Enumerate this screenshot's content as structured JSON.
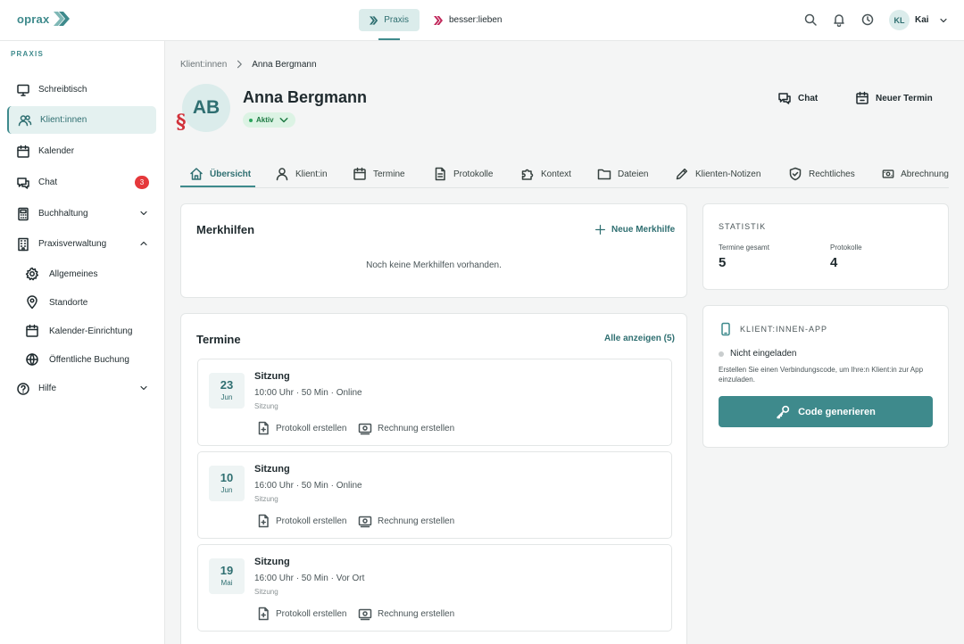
{
  "topbar": {
    "logo_text": "oprax",
    "workspaces": [
      {
        "label": "Praxis",
        "active": true
      },
      {
        "label": "besser:lieben",
        "active": false
      }
    ],
    "icons": [
      "search-icon",
      "bell-icon",
      "clock-icon"
    ],
    "user": {
      "initials": "KL",
      "name": "Kai"
    }
  },
  "sidebar": {
    "section": "PRAXIS",
    "items": [
      {
        "label": "Schreibtisch",
        "icon": "monitor-icon"
      },
      {
        "label": "Klient:innen",
        "icon": "users-icon",
        "active": true
      },
      {
        "label": "Kalender",
        "icon": "calendar-icon"
      },
      {
        "label": "Chat",
        "icon": "chat-icon",
        "badge": "3"
      },
      {
        "label": "Buchhaltung",
        "icon": "calculator-icon",
        "expandable": true
      },
      {
        "label": "Praxisverwaltung",
        "icon": "building-icon",
        "expanded": true
      },
      {
        "label": "Hilfe",
        "icon": "help-icon",
        "expandable": true
      }
    ],
    "subitems": [
      {
        "label": "Allgemeines",
        "icon": "gear-icon"
      },
      {
        "label": "Standorte",
        "icon": "map-pin-icon"
      },
      {
        "label": "Kalender-Einrichtung",
        "icon": "calendar-icon"
      },
      {
        "label": "Öffentliche Buchung",
        "icon": "globe-icon"
      }
    ]
  },
  "breadcrumb": {
    "parent": "Klient:innen",
    "current": "Anna Bergmann"
  },
  "client": {
    "initials": "AB",
    "name": "Anna Bergmann",
    "status": "Aktiv",
    "mark": "§"
  },
  "header_actions": {
    "chat": "Chat",
    "new_appointment": "Neuer Termin"
  },
  "tabs": [
    {
      "label": "Übersicht",
      "icon": "home-icon",
      "active": true
    },
    {
      "label": "Klient:in",
      "icon": "user-icon"
    },
    {
      "label": "Termine",
      "icon": "calendar-icon"
    },
    {
      "label": "Protokolle",
      "icon": "document-icon"
    },
    {
      "label": "Kontext",
      "icon": "puzzle-icon"
    },
    {
      "label": "Dateien",
      "icon": "folder-icon"
    },
    {
      "label": "Klienten-Notizen",
      "icon": "pen-icon"
    },
    {
      "label": "Rechtliches",
      "icon": "shield-icon"
    },
    {
      "label": "Abrechnung",
      "icon": "money-icon"
    }
  ],
  "merkhilfen": {
    "title": "Merkhilfen",
    "add_label": "Neue Merkhilfe",
    "empty": "Noch keine Merkhilfen vorhanden."
  },
  "termine": {
    "title": "Termine",
    "show_all": "Alle anzeigen (5)",
    "items": [
      {
        "day": "23",
        "month": "Jun",
        "title": "Sitzung",
        "meta": "10:00 Uhr · 50 Min · Online",
        "type": "Sitzung"
      },
      {
        "day": "10",
        "month": "Jun",
        "title": "Sitzung",
        "meta": "16:00 Uhr · 50 Min · Online",
        "type": "Sitzung"
      },
      {
        "day": "19",
        "month": "Mai",
        "title": "Sitzung",
        "meta": "16:00 Uhr · 50 Min · Vor Ort",
        "type": "Sitzung"
      }
    ],
    "action_protocol": "Protokoll erstellen",
    "action_invoice": "Rechnung erstellen"
  },
  "statistik": {
    "title": "STATISTIK",
    "appointments_label": "Termine gesamt",
    "appointments_value": "5",
    "protocols_label": "Protokolle",
    "protocols_value": "4"
  },
  "client_app": {
    "title": "KLIENT:INNEN-APP",
    "status": "Nicht eingeladen",
    "description": "Erstellen Sie einen Verbindungscode, um Ihre:n Klient:in zur App einzuladen.",
    "button": "Code generieren"
  },
  "colors": {
    "accent": "#3e8a8c",
    "accent_light": "#dbeceb",
    "badge": "#e5383b",
    "status": "#2aa55c"
  }
}
